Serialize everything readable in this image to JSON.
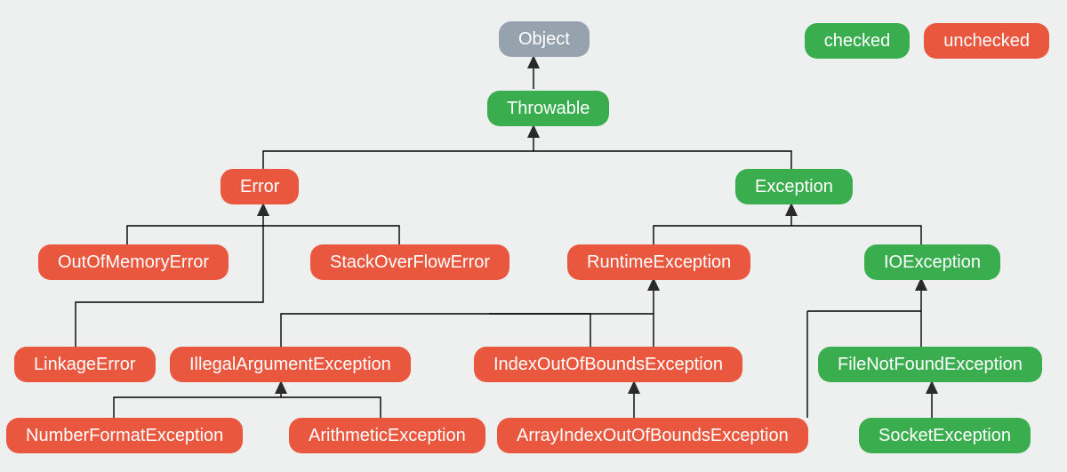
{
  "legend": {
    "checked": "checked",
    "unchecked": "unchecked"
  },
  "nodes": {
    "object": "Object",
    "throwable": "Throwable",
    "error": "Error",
    "exception": "Exception",
    "oome": "OutOfMemoryError",
    "sofe": "StackOverFlowError",
    "runtime": "RuntimeException",
    "io": "IOException",
    "linkage": "LinkageError",
    "illegalarg": "IllegalArgumentException",
    "ioobe": "IndexOutOfBoundsException",
    "filenf": "FileNotFoundException",
    "nfe": "NumberFormatException",
    "arith": "ArithmeticException",
    "aioobe": "ArrayIndexOutOfBoundsException",
    "socket": "SocketException"
  },
  "chart_data": {
    "type": "tree",
    "title": "",
    "legend": [
      {
        "label": "checked",
        "color": "#3aad4f"
      },
      {
        "label": "unchecked",
        "color": "#e9573e"
      }
    ],
    "nodes": [
      {
        "id": "Object",
        "kind": "root",
        "color": "#96a3ae"
      },
      {
        "id": "Throwable",
        "kind": "checked",
        "color": "#3aad4f",
        "parent": "Object"
      },
      {
        "id": "Error",
        "kind": "unchecked",
        "color": "#e9573e",
        "parent": "Throwable"
      },
      {
        "id": "Exception",
        "kind": "checked",
        "color": "#3aad4f",
        "parent": "Throwable"
      },
      {
        "id": "OutOfMemoryError",
        "kind": "unchecked",
        "color": "#e9573e",
        "parent": "Error"
      },
      {
        "id": "StackOverFlowError",
        "kind": "unchecked",
        "color": "#e9573e",
        "parent": "Error"
      },
      {
        "id": "LinkageError",
        "kind": "unchecked",
        "color": "#e9573e",
        "parent": "Error"
      },
      {
        "id": "RuntimeException",
        "kind": "unchecked",
        "color": "#e9573e",
        "parent": "Exception"
      },
      {
        "id": "IOException",
        "kind": "checked",
        "color": "#3aad4f",
        "parent": "Exception"
      },
      {
        "id": "IllegalArgumentException",
        "kind": "unchecked",
        "color": "#e9573e",
        "parent": "RuntimeException"
      },
      {
        "id": "IndexOutOfBoundsException",
        "kind": "unchecked",
        "color": "#e9573e",
        "parent": "RuntimeException"
      },
      {
        "id": "FileNotFoundException",
        "kind": "checked",
        "color": "#3aad4f",
        "parent": "IOException"
      },
      {
        "id": "SocketException",
        "kind": "checked",
        "color": "#3aad4f",
        "parent": "IOException"
      },
      {
        "id": "NumberFormatException",
        "kind": "unchecked",
        "color": "#e9573e",
        "parent": "IllegalArgumentException"
      },
      {
        "id": "ArithmeticException",
        "kind": "unchecked",
        "color": "#e9573e",
        "parent": "IllegalArgumentException"
      },
      {
        "id": "ArrayIndexOutOfBoundsException",
        "kind": "unchecked",
        "color": "#e9573e",
        "parent": "IndexOutOfBoundsException"
      }
    ]
  }
}
